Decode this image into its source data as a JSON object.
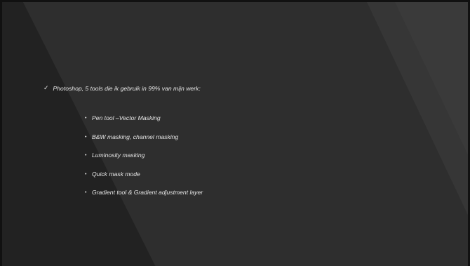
{
  "slide": {
    "headline_marker": "✓",
    "headline": "Photoshop, 5 tools die ik gebruik in  99% van mijn werk:",
    "bullet_marker": "•",
    "bullets": [
      "Pen tool –Vector Masking",
      "B&W masking, channel masking",
      "Luminosity masking",
      "Quick mask mode",
      "Gradient tool & Gradient adjustment layer"
    ]
  },
  "colors": {
    "background": "#2b2b2b",
    "shape_dark": "#1f1f1f",
    "shape_light": "#333333",
    "text": "#e6e6e6"
  }
}
